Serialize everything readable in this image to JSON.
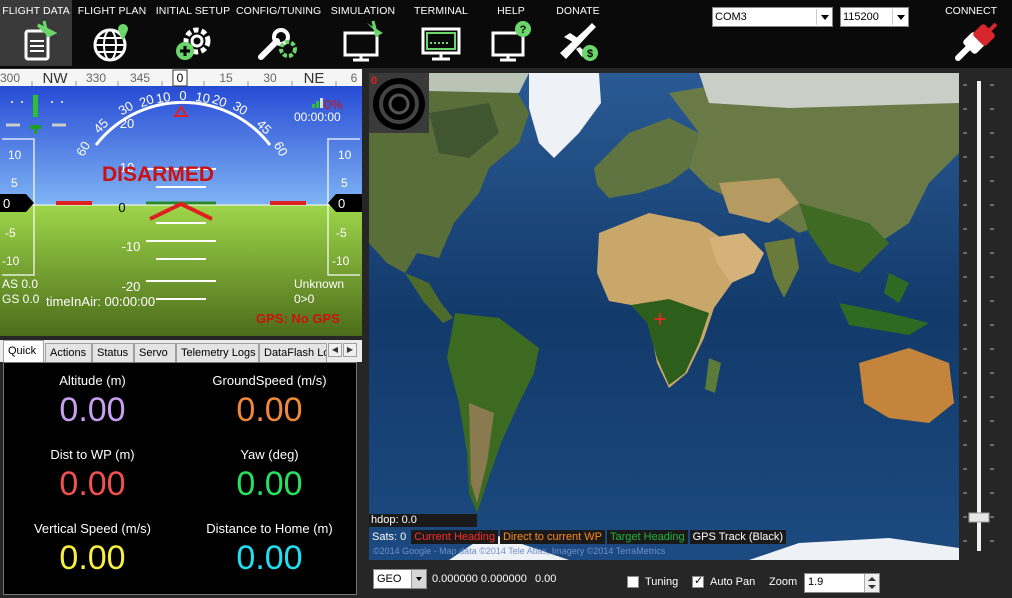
{
  "menu": {
    "items": [
      {
        "label": "FLIGHT DATA",
        "icon": "flight-data-icon"
      },
      {
        "label": "FLIGHT PLAN",
        "icon": "globe-icon"
      },
      {
        "label": "INITIAL SETUP",
        "icon": "gear-plus-icon"
      },
      {
        "label": "CONFIG/TUNING",
        "icon": "wrench-gear-icon"
      },
      {
        "label": "SIMULATION",
        "icon": "monitor-plane-icon"
      },
      {
        "label": "TERMINAL",
        "icon": "terminal-icon"
      },
      {
        "label": "HELP",
        "icon": "help-monitor-icon"
      },
      {
        "label": "DONATE",
        "icon": "plane-dollar-icon"
      }
    ],
    "port": "COM3",
    "baud": "115200",
    "connect_label": "CONNECT"
  },
  "hud": {
    "status": "DISARMED",
    "heading_tape": [
      "300",
      "NW",
      "330",
      "345",
      "0",
      "15",
      "30",
      "NE",
      "6"
    ],
    "heading_value": "0",
    "pitch_labels_up": [
      "10",
      "20"
    ],
    "pitch_labels_down": [
      "-10",
      "-20"
    ],
    "roll_labels": [
      "60",
      "45",
      "30",
      "20",
      "10",
      "0",
      "10",
      "20",
      "30",
      "45",
      "60"
    ],
    "battery_pct": "0%",
    "battery_time": "00:00:00",
    "left_tape": [
      "10",
      "5",
      "0",
      "-5",
      "-10"
    ],
    "right_tape": [
      "10",
      "5",
      "0",
      "-5",
      "-10"
    ],
    "left_value": "0",
    "right_value": "0",
    "airspeed": "AS 0.0",
    "groundspeed": "GS 0.0",
    "time_in_air": "timeInAir: 00:00:00",
    "mode": "Unknown",
    "wp": "0>0",
    "gps": "GPS: No GPS",
    "red_zero": "0",
    "status_color": "#cc1111"
  },
  "tabs": [
    "Quick",
    "Actions",
    "Status",
    "Servo",
    "Telemetry Logs",
    "DataFlash Lo"
  ],
  "quick": [
    {
      "label": "Altitude (m)",
      "value": "0.00",
      "color": "#c9a0f0"
    },
    {
      "label": "GroundSpeed (m/s)",
      "value": "0.00",
      "color": "#f0883a"
    },
    {
      "label": "Dist to WP (m)",
      "value": "0.00",
      "color": "#f05050"
    },
    {
      "label": "Yaw (deg)",
      "value": "0.00",
      "color": "#28e060"
    },
    {
      "label": "Vertical Speed (m/s)",
      "value": "0.00",
      "color": "#f8f040"
    },
    {
      "label": "Distance to Home (m)",
      "value": "0.00",
      "color": "#20e0f0"
    }
  ],
  "map": {
    "compass_value": "0",
    "hdop": "hdop: 0.0",
    "sats": "Sats: 0",
    "legend": [
      {
        "label": "Current Heading",
        "color": "#ff2a2a"
      },
      {
        "label": "Direct to current WP",
        "color": "#ff8a1a"
      },
      {
        "label": "Target Heading",
        "color": "#22b33a"
      },
      {
        "label": "GPS Track (Black)",
        "color": "#ffffff"
      }
    ],
    "copyright": "©2014 Google - Map data ©2014 Tele Atlas, Imagery ©2014 TerraMetrics"
  },
  "bottom": {
    "coord_mode": "GEO",
    "coords": "0.000000 0.000000",
    "alt": "0.00",
    "tuning_label": "Tuning",
    "tuning_checked": false,
    "autopan_label": "Auto Pan",
    "autopan_checked": true,
    "zoom_label": "Zoom",
    "zoom_value": "1.9"
  }
}
